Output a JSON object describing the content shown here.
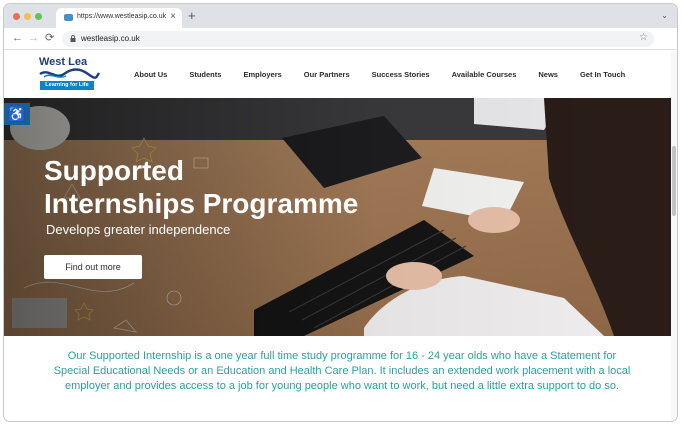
{
  "browser": {
    "tab_title": "https://www.westleasip.co.uk",
    "tab_close": "×",
    "new_tab": "+",
    "tab_menu": "⌄",
    "back": "←",
    "forward": "→",
    "reload": "⟳",
    "url": "westleasip.co.uk",
    "bookmark": "☆"
  },
  "site": {
    "logo_name": "West Lea",
    "logo_tagline": "Learning for Life",
    "nav": [
      "About Us",
      "Students",
      "Employers",
      "Our Partners",
      "Success Stories",
      "Available Courses",
      "News",
      "Get In Touch"
    ]
  },
  "hero": {
    "title_line1": "Supported",
    "title_line2": "Internships Programme",
    "subtitle": "Develops greater independence",
    "button": "Find out more",
    "accessibility_icon": "♿"
  },
  "intro_text": "Our Supported Internship is a one year full time study programme for 16 - 24 year olds who have a Statement for Special Educational Needs or an Education and Health Care Plan. It includes an extended work placement with a local employer and provides access to a job for young people who want to work, but need a little extra support to do so.",
  "colors": {
    "accent_teal": "#2f9ea0",
    "logo_navy": "#1f3f7a",
    "logo_blue": "#0d84c4"
  }
}
